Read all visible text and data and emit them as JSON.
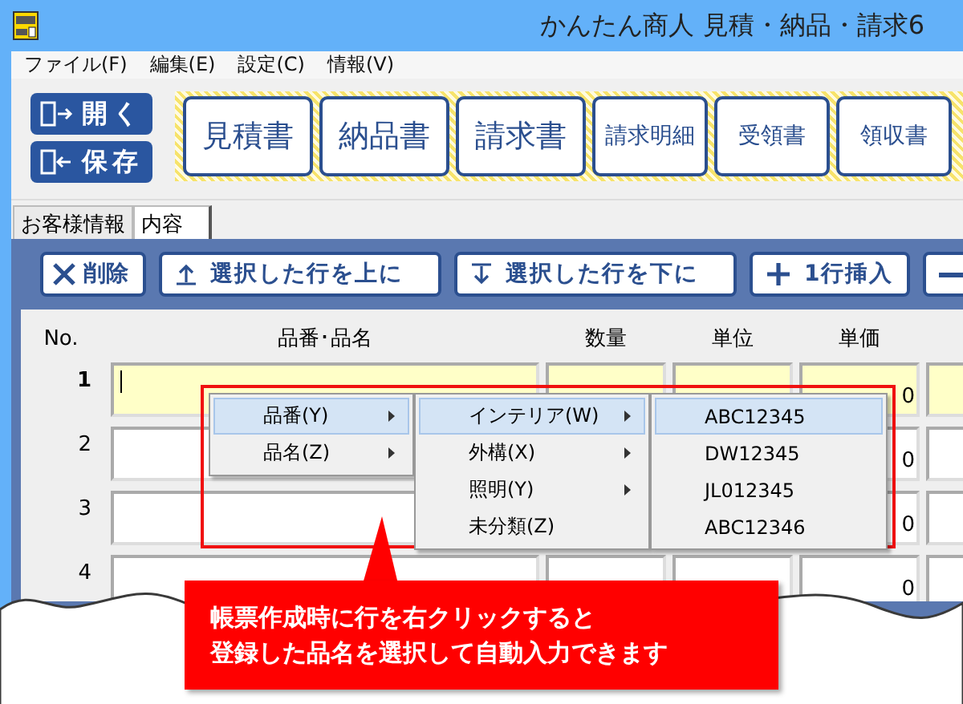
{
  "window": {
    "title": "かんたん商人 見積・納品・請求6"
  },
  "menu": [
    "ファイル(F)",
    "編集(E)",
    "設定(C)",
    "情報(V)"
  ],
  "file_buttons": [
    {
      "label": "開く",
      "kind": "open"
    },
    {
      "label": "保存",
      "kind": "save"
    }
  ],
  "document_buttons": [
    {
      "label": "見積書",
      "kind": "large"
    },
    {
      "label": "納品書",
      "kind": "large"
    },
    {
      "label": "請求書",
      "kind": "large"
    },
    {
      "label": "請求明細",
      "kind": "small"
    },
    {
      "label": "受領書",
      "kind": "small"
    },
    {
      "label": "領収書",
      "kind": "small"
    }
  ],
  "tabs": [
    {
      "label": "お客様情報",
      "selected": false
    },
    {
      "label": "内容",
      "selected": true
    }
  ],
  "row_actions": [
    {
      "label": "削除",
      "kind": "delete"
    },
    {
      "label": "選択した行を上に",
      "kind": "up"
    },
    {
      "label": "選択した行を下に",
      "kind": "down"
    },
    {
      "label": "1行挿入",
      "kind": "insert"
    },
    {
      "kind": "remove"
    }
  ],
  "table": {
    "columns": [
      "No.",
      "品番･品名",
      "数量",
      "単位",
      "単価"
    ],
    "rows": [
      {
        "no": "1",
        "selected": true,
        "unit_price": "0"
      },
      {
        "no": "2",
        "selected": false,
        "unit_price": "0"
      },
      {
        "no": "3",
        "selected": false,
        "unit_price": "0"
      },
      {
        "no": "4",
        "selected": false,
        "unit_price": "0"
      }
    ]
  },
  "context_menu": [
    [
      {
        "label": "品番(Y)",
        "submenu": true,
        "selected": true
      },
      {
        "label": "品名(Z)",
        "submenu": true,
        "selected": false
      }
    ],
    [
      {
        "label": "インテリア(W)",
        "submenu": true,
        "selected": true
      },
      {
        "label": "外構(X)",
        "submenu": true,
        "selected": false
      },
      {
        "label": "照明(Y)",
        "submenu": true,
        "selected": false
      },
      {
        "label": "未分類(Z)",
        "submenu": false,
        "selected": false
      }
    ],
    [
      {
        "label": "ABC12345",
        "submenu": false,
        "selected": true
      },
      {
        "label": "DW12345",
        "submenu": false,
        "selected": false
      },
      {
        "label": "JL012345",
        "submenu": false,
        "selected": false
      },
      {
        "label": "ABC12346",
        "submenu": false,
        "selected": false
      }
    ]
  ],
  "callout": {
    "lines": [
      "帳票作成時に行を右クリックすると",
      "登録した品名を選択して自動入力できます"
    ]
  }
}
